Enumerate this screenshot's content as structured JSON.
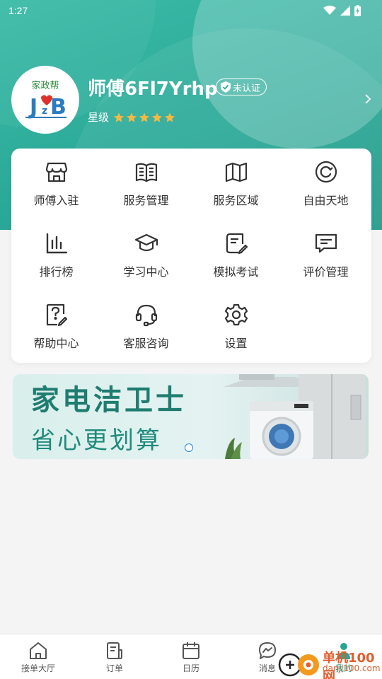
{
  "status_bar": {
    "time": "1:27"
  },
  "profile": {
    "avatar_brand": "家政帮",
    "avatar_letters": "JzB",
    "name": "师傅6Fl7Yrhp",
    "auth_badge": "未认证",
    "rating_label": "星级",
    "rating_stars": 5
  },
  "menu": {
    "items": [
      {
        "label": "师傅入驻",
        "icon": "storefront-icon"
      },
      {
        "label": "服务管理",
        "icon": "open-book-icon"
      },
      {
        "label": "服务区域",
        "icon": "map-icon"
      },
      {
        "label": "自由天地",
        "icon": "circle-arrow-icon"
      },
      {
        "label": "排行榜",
        "icon": "bar-chart-icon"
      },
      {
        "label": "学习中心",
        "icon": "graduation-cap-icon"
      },
      {
        "label": "模拟考试",
        "icon": "exam-paper-icon"
      },
      {
        "label": "评价管理",
        "icon": "comment-icon"
      },
      {
        "label": "帮助中心",
        "icon": "help-doc-icon"
      },
      {
        "label": "客服咨询",
        "icon": "headset-icon"
      },
      {
        "label": "设置",
        "icon": "gear-icon"
      }
    ]
  },
  "banner": {
    "title": "家电洁卫士",
    "subtitle": "省心更划算"
  },
  "tabbar": {
    "tabs": [
      {
        "label": "接单大厅",
        "icon": "home-icon"
      },
      {
        "label": "订单",
        "icon": "order-icon"
      },
      {
        "label": "日历",
        "icon": "calendar-icon"
      },
      {
        "label": "消息",
        "icon": "messenger-icon"
      },
      {
        "label": "我的",
        "icon": "person-icon",
        "active": true
      }
    ]
  },
  "watermark": {
    "line1": "单机100网",
    "line2": "danji100.com"
  },
  "colors": {
    "primary": "#26a594",
    "header": "#2aa897",
    "star": "#f5b942",
    "banner_text": "#1f7c70"
  }
}
